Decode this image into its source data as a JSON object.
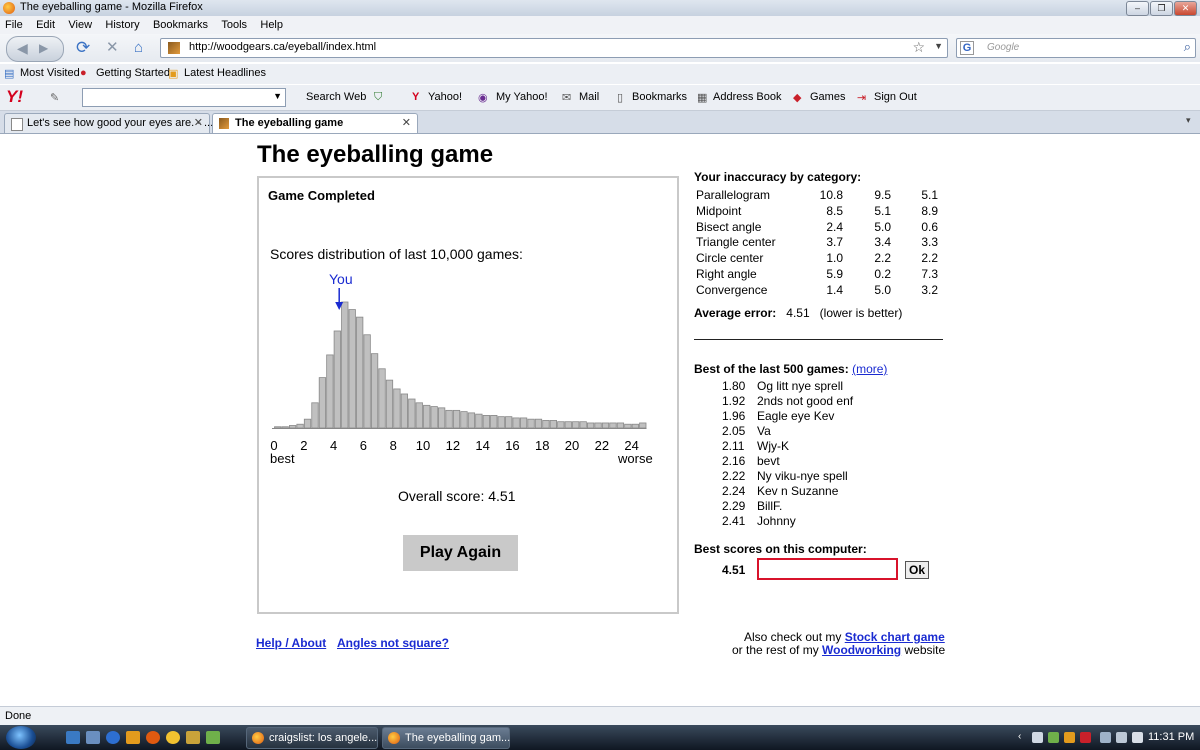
{
  "window": {
    "title": "The eyeballing game - Mozilla Firefox",
    "controls": {
      "minimize": "–",
      "maximize": "❐",
      "close": "✕"
    }
  },
  "menu": [
    "File",
    "Edit",
    "View",
    "History",
    "Bookmarks",
    "Tools",
    "Help"
  ],
  "nav": {
    "url": "http://woodgears.ca/eyeball/index.html",
    "search_placeholder": "Google",
    "search_engine_letter": "G"
  },
  "bookmarks": [
    "Most Visited",
    "Getting Started",
    "Latest Headlines"
  ],
  "yahoo_toolbar": {
    "logo": "Y!",
    "items": [
      "Search Web",
      "Yahoo!",
      "My Yahoo!",
      "Mail",
      "Bookmarks",
      "Address Book",
      "Games",
      "Sign Out"
    ]
  },
  "tabs": [
    {
      "label": "Let's see how good your eyes are. - ...",
      "active": false
    },
    {
      "label": "The eyeballing game",
      "active": true
    }
  ],
  "page": {
    "title": "The eyeballing game",
    "status": "Game Completed",
    "distribution_label": "Scores distribution of last 10,000 games:",
    "you_label": "You",
    "best_label": "best",
    "worse_label": "worse",
    "overall_score_text": "Overall score: 4.51",
    "play_again": "Play Again",
    "links": {
      "help": "Help / About",
      "angles": "Angles not square?"
    }
  },
  "chart_data": {
    "type": "bar",
    "x_ticks": [
      "0",
      "2",
      "4",
      "6",
      "8",
      "10",
      "12",
      "14",
      "16",
      "18",
      "20",
      "22",
      "24"
    ],
    "xlim": [
      0,
      25
    ],
    "bin_width": 0.5,
    "ylim": [
      0,
      100
    ],
    "you_marker_value": 4.51,
    "values": [
      1,
      1,
      2,
      3,
      7,
      20,
      40,
      58,
      77,
      100,
      94,
      88,
      74,
      59,
      47,
      38,
      31,
      27,
      23,
      20,
      18,
      17,
      16,
      14,
      14,
      13,
      12,
      11,
      10,
      10,
      9,
      9,
      8,
      8,
      7,
      7,
      6,
      6,
      5,
      5,
      5,
      5,
      4,
      4,
      4,
      4,
      4,
      3,
      3,
      4
    ]
  },
  "category": {
    "heading": "Your inaccuracy by category:",
    "rows": [
      {
        "name": "Parallelogram",
        "values": [
          "10.8",
          "9.5",
          "5.1"
        ]
      },
      {
        "name": "Midpoint",
        "values": [
          "8.5",
          "5.1",
          "8.9"
        ]
      },
      {
        "name": "Bisect angle",
        "values": [
          "2.4",
          "5.0",
          "0.6"
        ]
      },
      {
        "name": "Triangle center",
        "values": [
          "3.7",
          "3.4",
          "3.3"
        ]
      },
      {
        "name": "Circle center",
        "values": [
          "1.0",
          "2.2",
          "2.2"
        ]
      },
      {
        "name": "Right angle",
        "values": [
          "5.9",
          "0.2",
          "7.3"
        ]
      },
      {
        "name": "Convergence",
        "values": [
          "1.4",
          "5.0",
          "3.2"
        ]
      }
    ],
    "average_label": "Average error:",
    "average_value": "4.51",
    "average_note": "(lower is better)"
  },
  "best500": {
    "heading": "Best of the last 500 games:",
    "more": "(more)",
    "rows": [
      {
        "score": "1.80",
        "name": "Og litt nye sprell"
      },
      {
        "score": "1.92",
        "name": "2nds not good enf"
      },
      {
        "score": "1.96",
        "name": "Eagle eye Kev"
      },
      {
        "score": "2.05",
        "name": "Va"
      },
      {
        "score": "2.11",
        "name": "Wjy-K"
      },
      {
        "score": "2.16",
        "name": "bevt"
      },
      {
        "score": "2.22",
        "name": "Ny viku-nye spell"
      },
      {
        "score": "2.24",
        "name": "Kev n Suzanne"
      },
      {
        "score": "2.29",
        "name": "BillF."
      },
      {
        "score": "2.41",
        "name": "Johnny"
      }
    ]
  },
  "best_computer": {
    "heading": "Best scores on this computer:",
    "score": "4.51",
    "name_value": "",
    "ok": "Ok"
  },
  "also": {
    "line1_prefix": "Also check out my ",
    "line1_link": "Stock chart game",
    "line2_prefix": "or the rest of my ",
    "line2_link": "Woodworking",
    "line2_suffix": " website"
  },
  "statusbar": "Done",
  "taskbar": {
    "tasks": [
      {
        "label": "craigslist: los angele...",
        "active": false
      },
      {
        "label": "The eyeballing gam...",
        "active": true
      }
    ],
    "clock": "11:31 PM"
  }
}
